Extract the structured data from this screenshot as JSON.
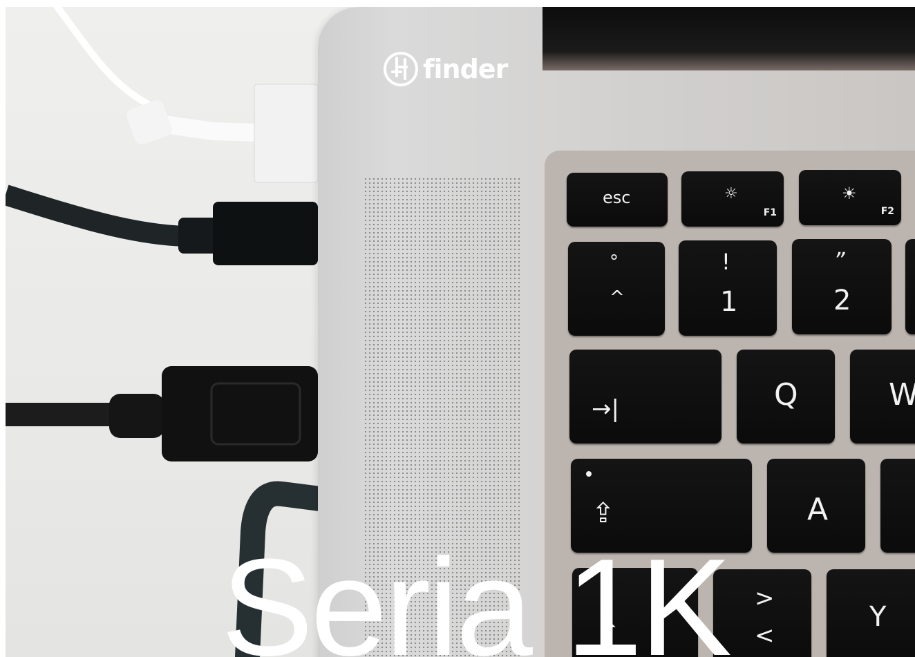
{
  "brand": {
    "logo_text": "finder",
    "logo_icon": "finder-logo-icon"
  },
  "title": "Seria 1K",
  "keyboard": {
    "esc": "esc",
    "f1": "F1",
    "f2": "F2",
    "degree": "°",
    "caret": "^",
    "excl": "!",
    "one": "1",
    "quote": "”",
    "two": "2",
    "tab_symbol": "→|",
    "q": "Q",
    "w": "W",
    "a": "A",
    "gt": ">",
    "lt": "<",
    "y": "Y",
    "shift_symbol": "⇧"
  },
  "colors": {
    "key": "#0f0f0f",
    "laptop": "#d4d3d2",
    "background": "#ecebea",
    "title_text": "#ffffff"
  }
}
